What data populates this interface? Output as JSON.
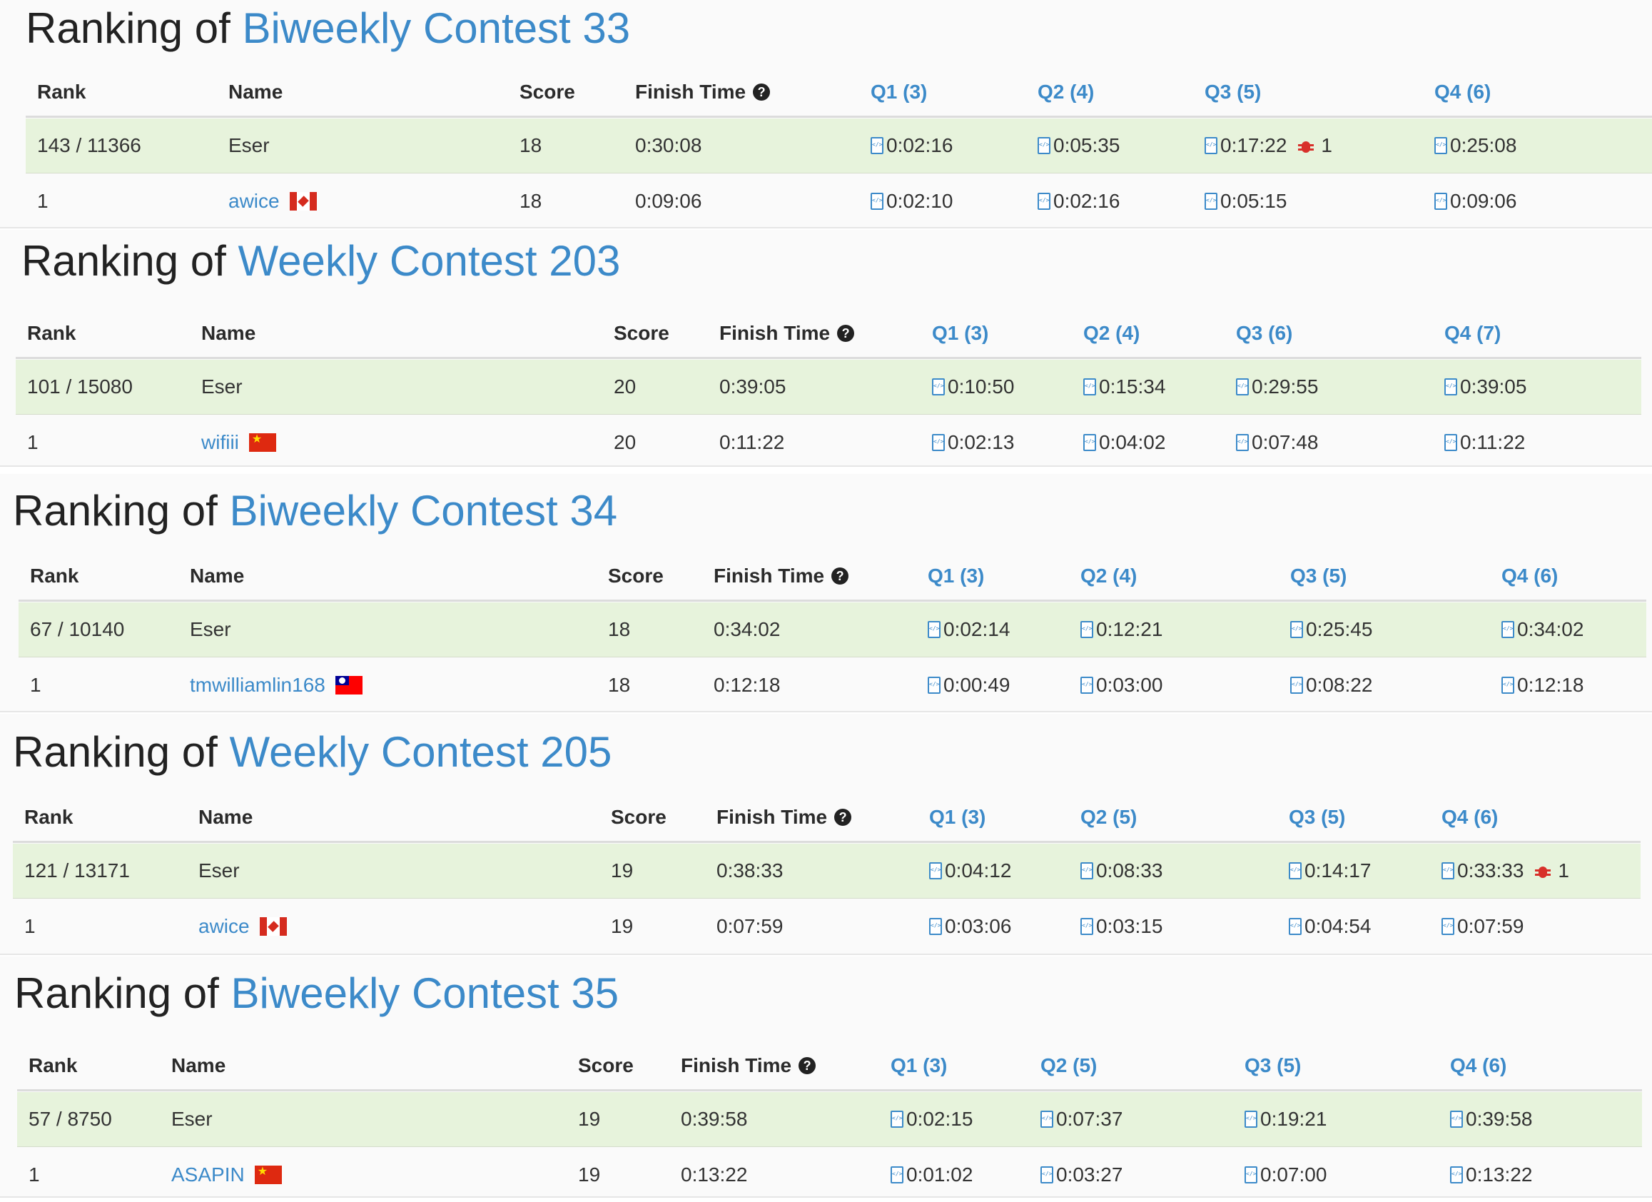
{
  "help_glyph": "?",
  "contests": [
    {
      "title_prefix": "Ranking of",
      "contest_name": "Biweekly Contest 33",
      "headers": {
        "rank": "Rank",
        "name": "Name",
        "score": "Score",
        "finish_time": "Finish Time",
        "q1": "Q1 (3)",
        "q2": "Q2 (4)",
        "q3": "Q3 (5)",
        "q4": "Q4 (6)"
      },
      "rows": [
        {
          "rank": "143 / 11366",
          "name": "Eser",
          "flag": "",
          "score": "18",
          "finish": "0:30:08",
          "q1": "0:02:16",
          "q2": "0:05:35",
          "q3": "0:17:22",
          "q3_bugs": "1",
          "q4": "0:25:08",
          "q4_bugs": ""
        },
        {
          "rank": "1",
          "name": "awice",
          "flag": "ca",
          "score": "18",
          "finish": "0:09:06",
          "q1": "0:02:10",
          "q2": "0:02:16",
          "q3": "0:05:15",
          "q3_bugs": "",
          "q4": "0:09:06",
          "q4_bugs": ""
        }
      ]
    },
    {
      "title_prefix": "Ranking of",
      "contest_name": "Weekly Contest 203",
      "headers": {
        "rank": "Rank",
        "name": "Name",
        "score": "Score",
        "finish_time": "Finish Time",
        "q1": "Q1 (3)",
        "q2": "Q2 (4)",
        "q3": "Q3 (6)",
        "q4": "Q4 (7)"
      },
      "rows": [
        {
          "rank": "101 / 15080",
          "name": "Eser",
          "flag": "",
          "score": "20",
          "finish": "0:39:05",
          "q1": "0:10:50",
          "q2": "0:15:34",
          "q3": "0:29:55",
          "q3_bugs": "",
          "q4": "0:39:05",
          "q4_bugs": ""
        },
        {
          "rank": "1",
          "name": "wifiii",
          "flag": "cn",
          "score": "20",
          "finish": "0:11:22",
          "q1": "0:02:13",
          "q2": "0:04:02",
          "q3": "0:07:48",
          "q3_bugs": "",
          "q4": "0:11:22",
          "q4_bugs": ""
        }
      ]
    },
    {
      "title_prefix": "Ranking of",
      "contest_name": "Biweekly Contest 34",
      "headers": {
        "rank": "Rank",
        "name": "Name",
        "score": "Score",
        "finish_time": "Finish Time",
        "q1": "Q1 (3)",
        "q2": "Q2 (4)",
        "q3": "Q3 (5)",
        "q4": "Q4 (6)"
      },
      "rows": [
        {
          "rank": "67 / 10140",
          "name": "Eser",
          "flag": "",
          "score": "18",
          "finish": "0:34:02",
          "q1": "0:02:14",
          "q2": "0:12:21",
          "q3": "0:25:45",
          "q3_bugs": "",
          "q4": "0:34:02",
          "q4_bugs": ""
        },
        {
          "rank": "1",
          "name": "tmwilliamlin168",
          "flag": "tw",
          "score": "18",
          "finish": "0:12:18",
          "q1": "0:00:49",
          "q2": "0:03:00",
          "q3": "0:08:22",
          "q3_bugs": "",
          "q4": "0:12:18",
          "q4_bugs": ""
        }
      ]
    },
    {
      "title_prefix": "Ranking of",
      "contest_name": "Weekly Contest 205",
      "headers": {
        "rank": "Rank",
        "name": "Name",
        "score": "Score",
        "finish_time": "Finish Time",
        "q1": "Q1 (3)",
        "q2": "Q2 (5)",
        "q3": "Q3 (5)",
        "q4": "Q4 (6)"
      },
      "rows": [
        {
          "rank": "121 / 13171",
          "name": "Eser",
          "flag": "",
          "score": "19",
          "finish": "0:38:33",
          "q1": "0:04:12",
          "q2": "0:08:33",
          "q3": "0:14:17",
          "q3_bugs": "",
          "q4": "0:33:33",
          "q4_bugs": "1"
        },
        {
          "rank": "1",
          "name": "awice",
          "flag": "ca",
          "score": "19",
          "finish": "0:07:59",
          "q1": "0:03:06",
          "q2": "0:03:15",
          "q3": "0:04:54",
          "q3_bugs": "",
          "q4": "0:07:59",
          "q4_bugs": ""
        }
      ]
    },
    {
      "title_prefix": "Ranking of",
      "contest_name": "Biweekly Contest 35",
      "headers": {
        "rank": "Rank",
        "name": "Name",
        "score": "Score",
        "finish_time": "Finish Time",
        "q1": "Q1 (3)",
        "q2": "Q2 (5)",
        "q3": "Q3 (5)",
        "q4": "Q4 (6)"
      },
      "rows": [
        {
          "rank": "57 / 8750",
          "name": "Eser",
          "flag": "",
          "score": "19",
          "finish": "0:39:58",
          "q1": "0:02:15",
          "q2": "0:07:37",
          "q3": "0:19:21",
          "q3_bugs": "",
          "q4": "0:39:58",
          "q4_bugs": ""
        },
        {
          "rank": "1",
          "name": "ASAPIN",
          "flag": "cn",
          "score": "19",
          "finish": "0:13:22",
          "q1": "0:01:02",
          "q2": "0:03:27",
          "q3": "0:07:00",
          "q3_bugs": "",
          "q4": "0:13:22",
          "q4_bugs": ""
        }
      ]
    }
  ]
}
